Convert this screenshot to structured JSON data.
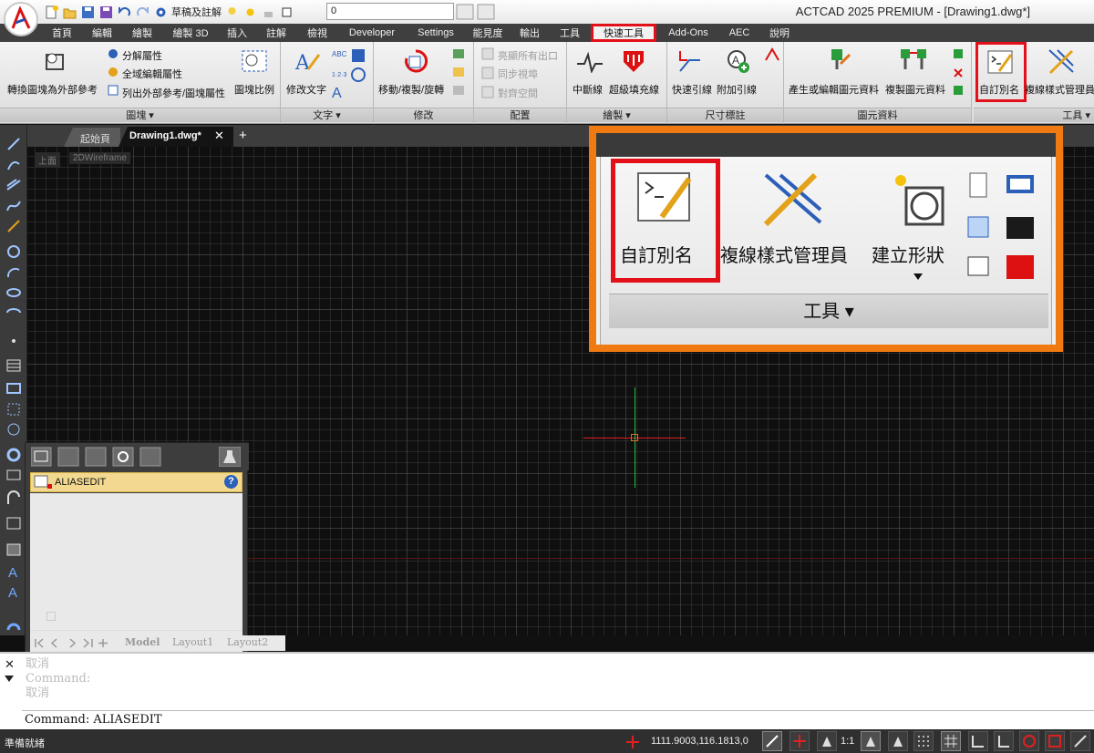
{
  "title": "ACTCAD 2025 PREMIUM - [Drawing1.dwg*]",
  "qat": {
    "workspace": "草稿及註解",
    "layer_value": "0"
  },
  "menu": {
    "tabs": [
      "首頁",
      "編輯",
      "繪製",
      "繪製 3D",
      "插入",
      "註解",
      "檢視",
      "Developer",
      "Settings",
      "能見度",
      "輸出",
      "工具",
      "快速工具",
      "Add-Ons",
      "AEC",
      "說明"
    ],
    "active_tab": "快速工具"
  },
  "ribbon": {
    "block": {
      "convert_label": "轉換圖塊為外部參考",
      "explode_attr": "分解屬性",
      "global_edit_attr": "全域編輯屬性",
      "list_xref": "列出外部參考/圖塊屬性",
      "block_scale": "圖塊比例",
      "title": "圖塊 ▾"
    },
    "text": {
      "modify_text": "修改文字",
      "title": "文字 ▾"
    },
    "modify": {
      "move_copy_rotate": "移動/複製/旋轉",
      "title": "修改"
    },
    "layout": {
      "item1": "亮顯所有出口",
      "item2": "同步視埠",
      "item3": "對齊空間",
      "title": "配置"
    },
    "draw": {
      "break_line": "中斷線",
      "super_hatch": "超級填充線",
      "title": "繪製 ▾"
    },
    "dim": {
      "quick_leader": "快速引線",
      "attach_leader": "附加引線",
      "title": "尺寸標註"
    },
    "attr": {
      "create_edit": "產生或編輯圖元資料",
      "copy_data": "複製圖元資料",
      "title": "圖元資料"
    },
    "tools": {
      "alias_edit": "自訂別名",
      "mline_style": "複線樣式管理員",
      "title": "工具 ▾"
    }
  },
  "doc_tabs": {
    "start": "起始頁",
    "drawing": "Drawing1.dwg*",
    "close": "✕",
    "add": "+"
  },
  "viewport": {
    "view": "上面",
    "style": "2DWireframe"
  },
  "callout": {
    "alias_edit": "自訂別名",
    "mline_style": "複線樣式管理員",
    "create_shape": "建立形狀",
    "panel_title": "工具 ▾"
  },
  "alias_panel": {
    "header": "ALIASEDIT",
    "help": "?"
  },
  "layout_tabs": {
    "model": "Model",
    "layout1": "Layout1",
    "layout2": "Layout2"
  },
  "command": {
    "history": [
      "取消",
      "Command:",
      "取消"
    ],
    "current": "Command: ALIASEDIT"
  },
  "status": {
    "ready": "準備就緒",
    "coords": "1111.9003,116.1813,0",
    "scale": "1:1"
  },
  "colors": {
    "highlight_red": "#e3101a",
    "callout_orange": "#f07a12",
    "crosshair_red": "#e02020",
    "crosshair_green": "#22c040"
  }
}
